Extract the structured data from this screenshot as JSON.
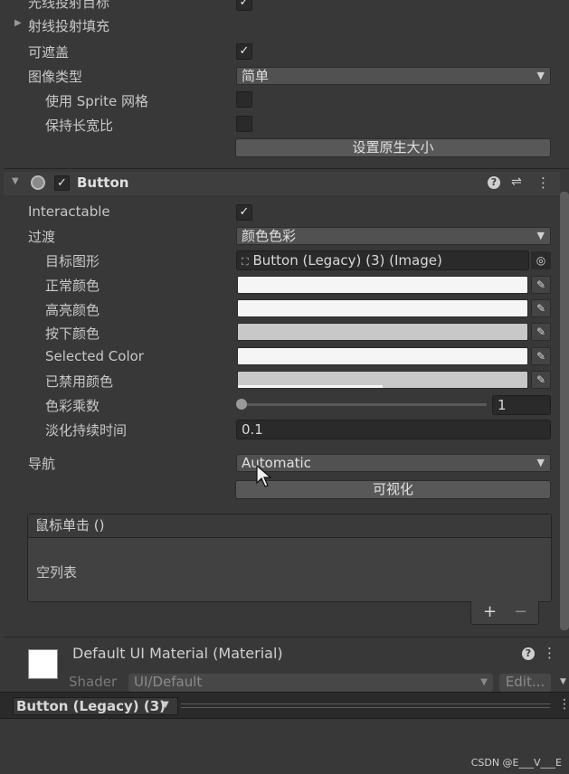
{
  "image_component": {
    "raycast_target_label": "光线投射目标",
    "raycast_padding_label": "射线投射填充",
    "maskable_label": "可遮盖",
    "image_type_label": "图像类型",
    "image_type_value": "简单",
    "use_sprite_mesh_label": "使用 Sprite 网格",
    "preserve_aspect_label": "保持长宽比",
    "set_native_size_label": "设置原生大小"
  },
  "button_component": {
    "title": "Button",
    "interactable_label": "Interactable",
    "transition_label": "过渡",
    "transition_value": "颜色色彩",
    "target_graphic_label": "目标图形",
    "target_graphic_value": "Button (Legacy) (3) (Image)",
    "normal_color_label": "正常颜色",
    "highlighted_color_label": "高亮颜色",
    "pressed_color_label": "按下颜色",
    "selected_color_label": "Selected Color",
    "disabled_color_label": "已禁用颜色",
    "color_multiplier_label": "色彩乘数",
    "color_multiplier_value": "1",
    "color_multiplier_level": 0,
    "fade_duration_label": "淡化持续时间",
    "fade_duration_value": "0.1",
    "navigation_label": "导航",
    "navigation_value": "Automatic",
    "visualize_label": "可视化",
    "onclick_label": "鼠标单击 ()",
    "empty_list_label": "空列表",
    "add_label": "+",
    "remove_label": "−",
    "colors": {
      "normal": "#f5f5f5",
      "highlighted": "#f5f5f5",
      "pressed": "#c8c8c8",
      "selected": "#f5f5f5",
      "disabled": "#c8c8c8"
    }
  },
  "material": {
    "title": "Default UI Material (Material)",
    "shader_label": "Shader",
    "shader_value": "UI/Default",
    "edit_label": "Edit..."
  },
  "preview_bar": {
    "title": "Button (Legacy) (3)"
  },
  "icons": {
    "check": "✓",
    "dropdown_arrow": "▼",
    "fold_right": "▶",
    "fold_down": "▼",
    "help": "?",
    "presets": "⇌",
    "menu": "⋮",
    "eyedropper": "✎",
    "target": "◎"
  },
  "watermark": "CSDN @E___V___E"
}
